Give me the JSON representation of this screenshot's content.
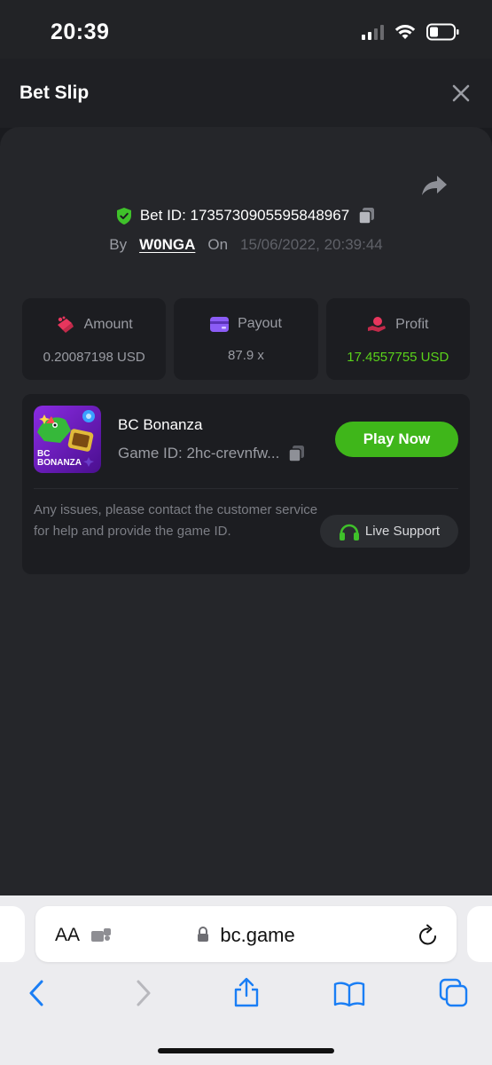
{
  "status_bar": {
    "time": "20:39"
  },
  "header": {
    "title": "Bet Slip"
  },
  "bet": {
    "id_label": "Bet ID: 1735730905595848967",
    "by_label": "By",
    "user": "W0NGA",
    "on_label": "On",
    "date": "15/06/2022, 20:39:44"
  },
  "stats": [
    {
      "label": "Amount",
      "value": "0.20087198 USD",
      "icon": "amount-icon",
      "color": "#e8365d"
    },
    {
      "label": "Payout",
      "value": "87.9 x",
      "icon": "payout-card-icon",
      "color": "#8b5cf6"
    },
    {
      "label": "Profit",
      "value": "17.4557755 USD",
      "icon": "profit-icon",
      "color": "#e8365d"
    }
  ],
  "game": {
    "thumb_line1": "BC",
    "thumb_line2": "BONANZA",
    "name": "BC Bonanza",
    "id_label": "Game ID: 2hc-crevnfw...",
    "play_label": "Play Now",
    "issues_text": "Any issues, please contact the customer service for help and provide the game ID.",
    "support_label": "Live Support"
  },
  "safari": {
    "aa_label": "AA",
    "url": "bc.game"
  },
  "colors": {
    "accent_green": "#3fb61a",
    "profit_green": "#5ad21a",
    "background": "#25262a"
  }
}
